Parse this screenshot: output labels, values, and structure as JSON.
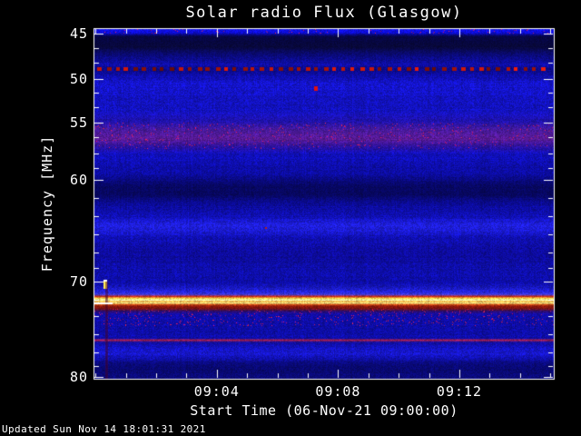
{
  "footer": {
    "updated": "Updated Sun Nov 14 18:01:31 2021"
  },
  "chart_data": {
    "type": "heatmap",
    "subtype": "solar-radio-spectrogram",
    "title": "Solar radio Flux (Glasgow)",
    "xlabel": "Start Time (06-Nov-21 09:00:00)",
    "ylabel": "Frequency [MHz]",
    "legend": "none",
    "grid": false,
    "x_axis": {
      "label": "Start Time (06-Nov-21 09:00:00)",
      "start_time": "09:00:00",
      "end_time": "09:15:10",
      "major_ticks": [
        {
          "label": "09:04",
          "minute": 4
        },
        {
          "label": "09:08",
          "minute": 8
        },
        {
          "label": "09:12",
          "minute": 12
        }
      ],
      "minor_tick_every_minutes": 1,
      "range_minutes": [
        0,
        15.1
      ]
    },
    "y_axis": {
      "label": "Frequency [MHz]",
      "inverted": true,
      "range_mhz": [
        44.4,
        80.3
      ],
      "major_ticks": [
        {
          "label": "45",
          "freq": 45
        },
        {
          "label": "50",
          "freq": 50
        },
        {
          "label": "55",
          "freq": 55
        },
        {
          "label": "60",
          "freq": 60
        },
        {
          "label": "70",
          "freq": 70
        },
        {
          "label": "80",
          "freq": 80
        }
      ],
      "minor_tick_freqs": [
        46.6,
        48.2,
        51.6,
        53.2,
        56.3,
        57.7,
        59.0,
        61.8,
        63.6,
        65.4,
        67.1,
        68.7,
        71.9,
        73.6,
        75.5,
        77.4,
        78.9
      ]
    },
    "colors": {
      "background": "#000000",
      "axis": "#ffffff",
      "text": "#ffffff",
      "base_blue": "#0000c8",
      "rfi_red": "#dd1605",
      "calibration_yellow": "#ffff66",
      "band_purple": "#58209a"
    },
    "intensity_stops": [
      [
        44.4,
        18,
        18,
        230
      ],
      [
        44.85,
        12,
        12,
        215
      ],
      [
        45.25,
        6,
        6,
        70
      ],
      [
        46.4,
        8,
        8,
        58
      ],
      [
        47.4,
        10,
        10,
        125
      ],
      [
        48.4,
        14,
        14,
        172
      ],
      [
        48.85,
        10,
        10,
        138
      ],
      [
        49.3,
        12,
        12,
        158
      ],
      [
        50.4,
        20,
        20,
        202
      ],
      [
        53.5,
        18,
        18,
        192
      ],
      [
        54.9,
        32,
        18,
        168
      ],
      [
        55.6,
        72,
        26,
        158
      ],
      [
        56.4,
        88,
        26,
        148
      ],
      [
        57.1,
        42,
        18,
        162
      ],
      [
        57.7,
        16,
        16,
        188
      ],
      [
        59.4,
        12,
        12,
        162
      ],
      [
        60.5,
        7,
        7,
        98
      ],
      [
        61.4,
        7,
        7,
        94
      ],
      [
        62.3,
        11,
        11,
        152
      ],
      [
        63.6,
        16,
        16,
        182
      ],
      [
        64.4,
        32,
        32,
        222
      ],
      [
        64.9,
        28,
        28,
        212
      ],
      [
        65.6,
        16,
        16,
        180
      ],
      [
        66.6,
        14,
        12,
        165
      ],
      [
        67.4,
        13,
        11,
        156
      ],
      [
        68.7,
        14,
        14,
        170
      ],
      [
        70.1,
        13,
        13,
        166
      ],
      [
        71.0,
        34,
        34,
        222
      ],
      [
        71.3,
        58,
        58,
        232
      ],
      [
        71.52,
        200,
        45,
        18
      ],
      [
        71.72,
        250,
        220,
        80
      ],
      [
        71.9,
        255,
        255,
        170
      ],
      [
        72.05,
        238,
        152,
        45
      ],
      [
        72.2,
        255,
        246,
        145
      ],
      [
        72.33,
        212,
        92,
        25
      ],
      [
        72.52,
        150,
        25,
        12
      ],
      [
        72.8,
        115,
        18,
        18
      ],
      [
        73.05,
        45,
        12,
        108
      ],
      [
        73.4,
        16,
        13,
        172
      ],
      [
        75.2,
        13,
        13,
        165
      ],
      [
        75.9,
        14,
        14,
        170
      ],
      [
        76.1,
        165,
        30,
        78
      ],
      [
        76.32,
        14,
        14,
        168
      ],
      [
        77.0,
        20,
        20,
        198
      ],
      [
        77.5,
        24,
        24,
        208
      ],
      [
        77.9,
        18,
        18,
        188
      ],
      [
        78.5,
        10,
        10,
        128
      ],
      [
        79.1,
        8,
        8,
        110
      ],
      [
        79.9,
        10,
        10,
        122
      ],
      [
        80.3,
        10,
        10,
        122
      ]
    ],
    "red_speckle_zones": [
      [
        44.4,
        44.9,
        0.03
      ],
      [
        55.0,
        57.3,
        0.035
      ],
      [
        72.85,
        74.6,
        0.05
      ]
    ],
    "features": [
      {
        "type": "dotted_line",
        "name": "rfi-dotted-line-49mhz",
        "freq_top": 48.72,
        "freq_bot": 49.1,
        "spacing_px": 10,
        "color": [
          225,
          25,
          8
        ]
      },
      {
        "type": "dot",
        "name": "rfi-burst-dot",
        "time_min": 7.2,
        "freq": 50.8,
        "w": 4,
        "h": 5,
        "color": [
          224,
          16,
          16
        ]
      },
      {
        "type": "dot",
        "name": "faint-red-dot",
        "time_min": 5.6,
        "freq": 64.6,
        "w": 2,
        "h": 2,
        "color": [
          176,
          32,
          32
        ]
      },
      {
        "type": "blip",
        "name": "calibration-blip",
        "time_min": 0.25,
        "freq_top": 69.8,
        "freq_bot": 70.8,
        "w": 4,
        "color": [
          255,
          238,
          85
        ]
      },
      {
        "type": "vline",
        "name": "interference-vertical-line",
        "time_min": 0.33,
        "freq_top": 70.0,
        "freq_bot": 80.3,
        "w": 3,
        "color": "rgba(70,0,35,0.5)"
      },
      {
        "type": "white_segment",
        "name": "white-line-start",
        "time_min0": -0.05,
        "time_min1": 0.55,
        "freq": 72.18,
        "h": 2,
        "color": "#ffffff"
      }
    ],
    "noise": {
      "pixel": 0.45,
      "column": 0.12,
      "row": 0.1
    }
  }
}
